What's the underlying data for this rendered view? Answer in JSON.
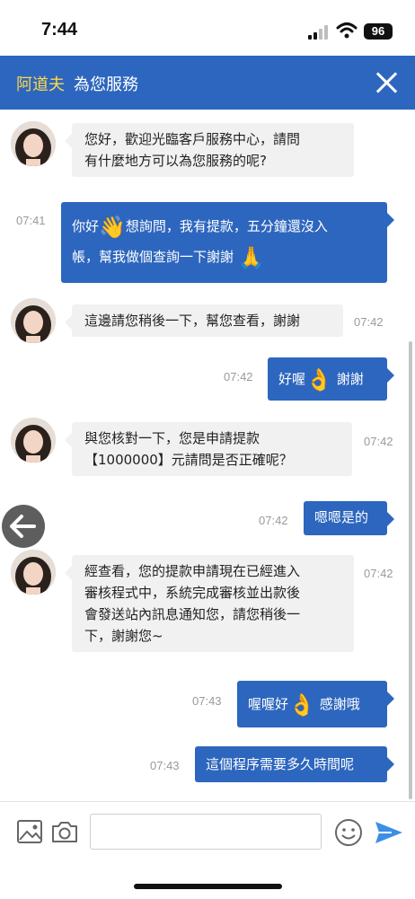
{
  "status": {
    "time": "7:44",
    "battery": "96"
  },
  "header": {
    "agent_name": "阿道夫",
    "subtitle": "為您服務"
  },
  "messages": [
    {
      "side": "in",
      "lines": [
        "您好，歡迎光臨客戶服務中心，請問",
        "有什麼地方可以為您服務的呢?"
      ],
      "time": ""
    },
    {
      "side": "out",
      "line1a": "你好",
      "line1b": "想詢問，我有提款，五分鐘還沒入",
      "line2": "帳，幫我做個查詢一下謝謝",
      "time": "07:41"
    },
    {
      "side": "in",
      "lines": [
        "這邊請您稍後一下，幫您查看，謝謝"
      ],
      "time": "07:42"
    },
    {
      "side": "out",
      "a": "好喔",
      "b": "謝謝",
      "time": "07:42"
    },
    {
      "side": "in",
      "lines": [
        "與您核對一下，您是申請提款",
        "【1000000】元請問是否正確呢？"
      ],
      "time": "07:42"
    },
    {
      "side": "out",
      "text": "嗯嗯是的",
      "time": "07:42"
    },
    {
      "side": "in",
      "lines": [
        "經查看，您的提款申請現在已經進入",
        "審核程式中，系統完成審核並出款後",
        "會發送站內訊息通知您，請您稍後一",
        "下，謝謝您~"
      ],
      "time": "07:42"
    },
    {
      "side": "out",
      "a": "喔喔好",
      "b": "感謝哦",
      "time": "07:43"
    },
    {
      "side": "out",
      "text": "這個程序需要多久時間呢",
      "time": "07:43"
    }
  ],
  "icons": {
    "wave": "👋",
    "pray": "🙏",
    "ok": "👌",
    "image": "image-icon",
    "camera": "camera-icon",
    "emoji": "smiley-icon",
    "send": "send-icon",
    "back": "back-arrow-icon"
  },
  "colors": {
    "header": "#2d66be",
    "agent_name": "#ffd84a",
    "outgoing_bubble": "#2d66be",
    "incoming_bubble": "#f1f1f1"
  }
}
